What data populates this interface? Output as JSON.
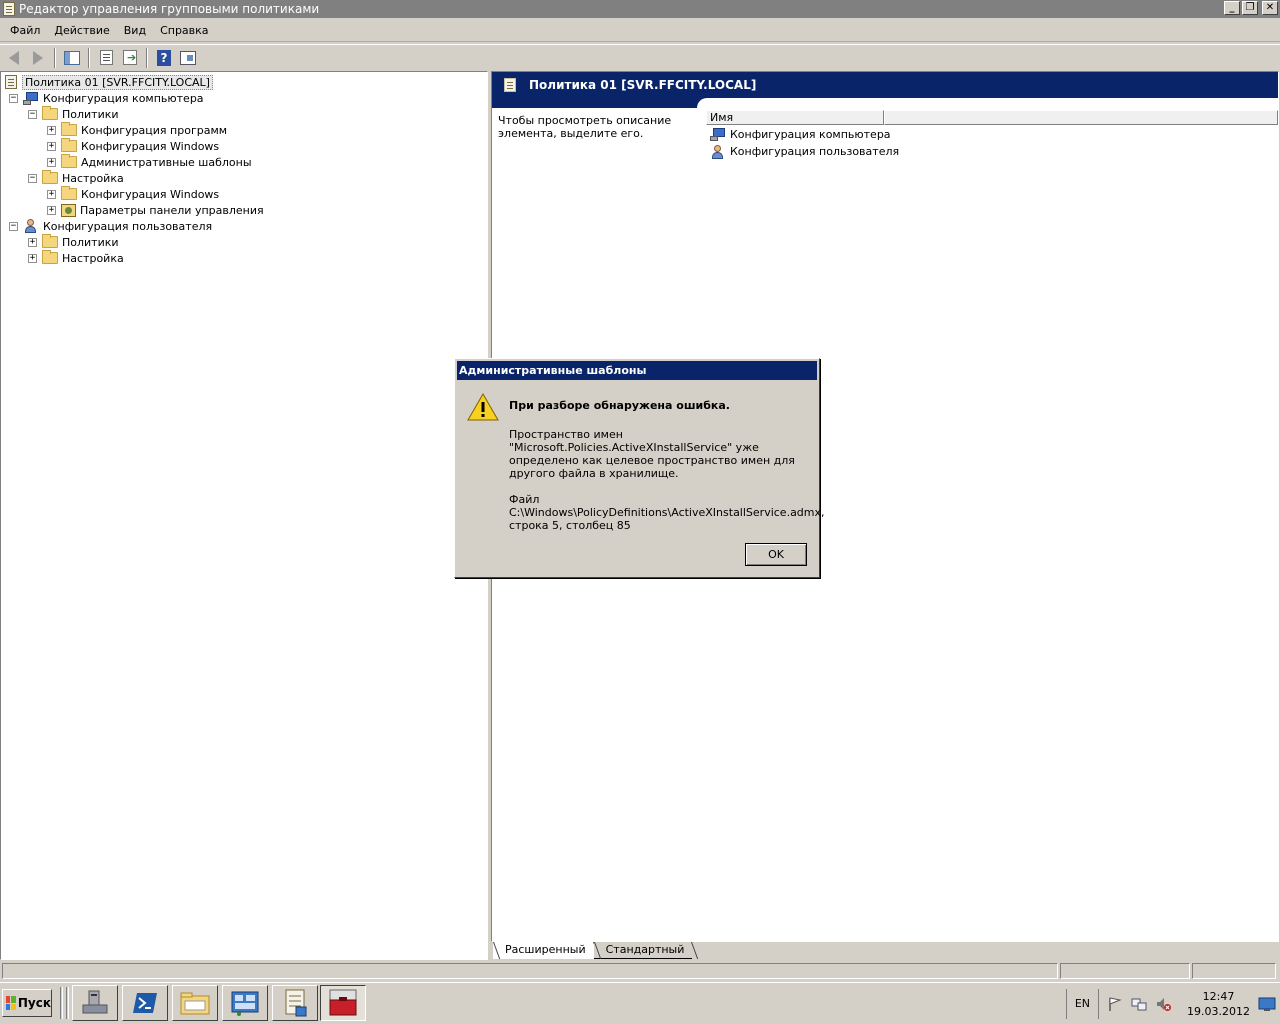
{
  "window": {
    "title": "Редактор управления групповыми политиками",
    "controls": [
      "minimize",
      "restore",
      "close"
    ]
  },
  "menu": [
    "Файл",
    "Действие",
    "Вид",
    "Справка"
  ],
  "toolbar": {
    "icons": [
      "back-icon",
      "forward-icon",
      "show-hide-tree-icon",
      "properties-icon",
      "export-list-icon",
      "help-icon",
      "view-icon"
    ]
  },
  "tree": {
    "root": "Политика 01 [SVR.FFCITY.LOCAL]",
    "computer_config": "Конфигурация компьютера",
    "policies": "Политики",
    "software_config": "Конфигурация программ",
    "windows_config": "Конфигурация Windows",
    "admin_templates": "Административные шаблоны",
    "preferences": "Настройка",
    "pref_windows_config": "Конфигурация Windows",
    "control_panel": "Параметры панели управления",
    "user_config": "Конфигурация пользователя",
    "user_policies": "Политики",
    "user_preferences": "Настройка"
  },
  "right_pane": {
    "title": "Политика 01 [SVR.FFCITY.LOCAL]",
    "description": "Чтобы просмотреть описание элемента, выделите его.",
    "column_name": "Имя",
    "items": [
      "Конфигурация компьютера",
      "Конфигурация пользователя"
    ]
  },
  "tabs": [
    "Расширенный",
    "Стандартный"
  ],
  "dialog": {
    "title": "Административные шаблоны",
    "heading": "При разборе обнаружена ошибка.",
    "message": "Пространство имен \"Microsoft.Policies.ActiveXInstallService\" уже определено как целевое пространство имен для другого файла в хранилище.",
    "file_label": "Файл",
    "file_path": "C:\\Windows\\PolicyDefinitions\\ActiveXInstallService.admx,",
    "location": "строка 5, столбец 85",
    "ok_label": "OK"
  },
  "taskbar": {
    "start_label": "Пуск",
    "language": "EN",
    "time": "12:47",
    "date": "19.03.2012"
  }
}
